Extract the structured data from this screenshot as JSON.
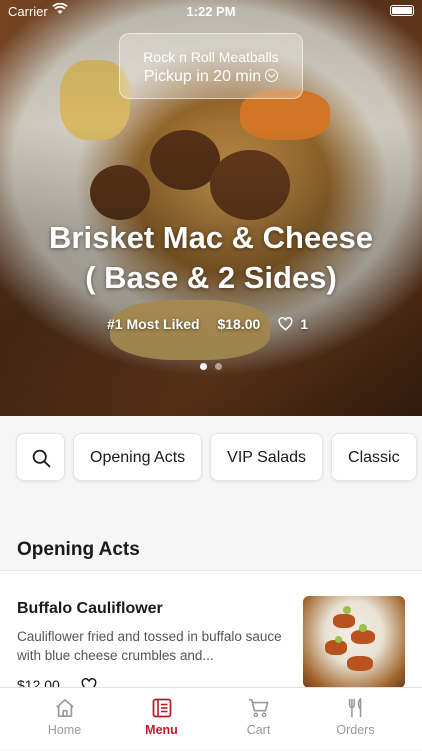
{
  "status_bar": {
    "carrier": "Carrier",
    "time": "1:22 PM"
  },
  "pickup": {
    "store": "Rock n Roll Meatballs",
    "time_label": "Pickup in 20 min"
  },
  "hero": {
    "title_line1": "Brisket Mac & Cheese",
    "title_line2": "( Base & 2 Sides)",
    "badge": "#1 Most Liked",
    "price": "$18.00",
    "likes": "1",
    "carousel_pages": 2,
    "carousel_active": 1
  },
  "categories": {
    "items": [
      "Opening Acts",
      "VIP Salads",
      "Classic"
    ]
  },
  "section": {
    "title": "Opening Acts"
  },
  "menu_item": {
    "name": "Buffalo Cauliflower",
    "description": "Cauliflower fried and tossed in buffalo sauce with blue cheese crumbles and...",
    "price": "$12.00"
  },
  "tabs": [
    {
      "label": "Home",
      "icon": "home-icon"
    },
    {
      "label": "Menu",
      "icon": "menu-icon"
    },
    {
      "label": "Cart",
      "icon": "cart-icon"
    },
    {
      "label": "Orders",
      "icon": "fork-knife-icon"
    }
  ],
  "colors": {
    "accent": "#c0182a",
    "inactive": "#999999"
  }
}
